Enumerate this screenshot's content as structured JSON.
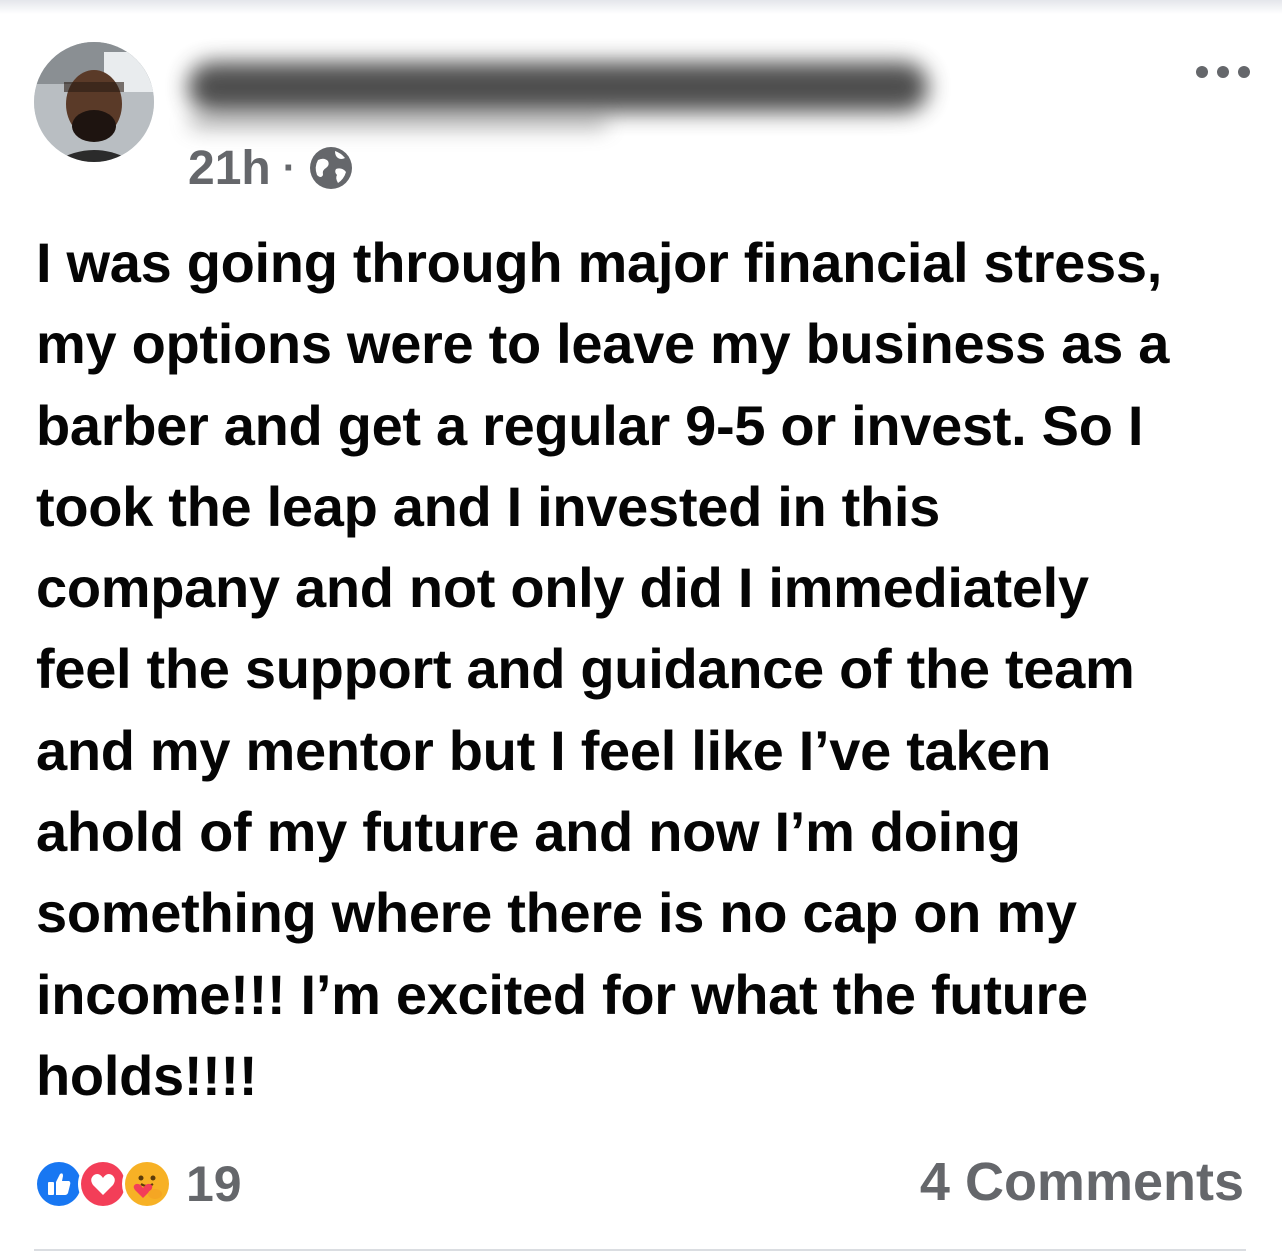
{
  "post": {
    "timestamp": "21h",
    "separator": "·",
    "audience_icon": "globe-icon",
    "more_icon": "more-options-icon",
    "text": "I was going through major financial stress,\nmy options were to leave my business as a\nbarber and get a regular 9-5 or invest. So I\ntook the leap and I invested in this\ncompany and not only did I immediately\nfeel the support and guidance of the team\nand my mentor but I feel like I’ve taken\nahold of my future and now I’m doing\nsomething where there is no cap on my\nincome!!! I’m excited for what the future\nholds!!!!"
  },
  "footer": {
    "reaction_icons": [
      "like-icon",
      "love-icon",
      "care-icon"
    ],
    "reaction_count": "19",
    "comments_label": "4 Comments"
  },
  "colors": {
    "like": "#1877f2",
    "love": "#f33e58",
    "care": "#f7b125",
    "secondary_text": "#65676b"
  }
}
